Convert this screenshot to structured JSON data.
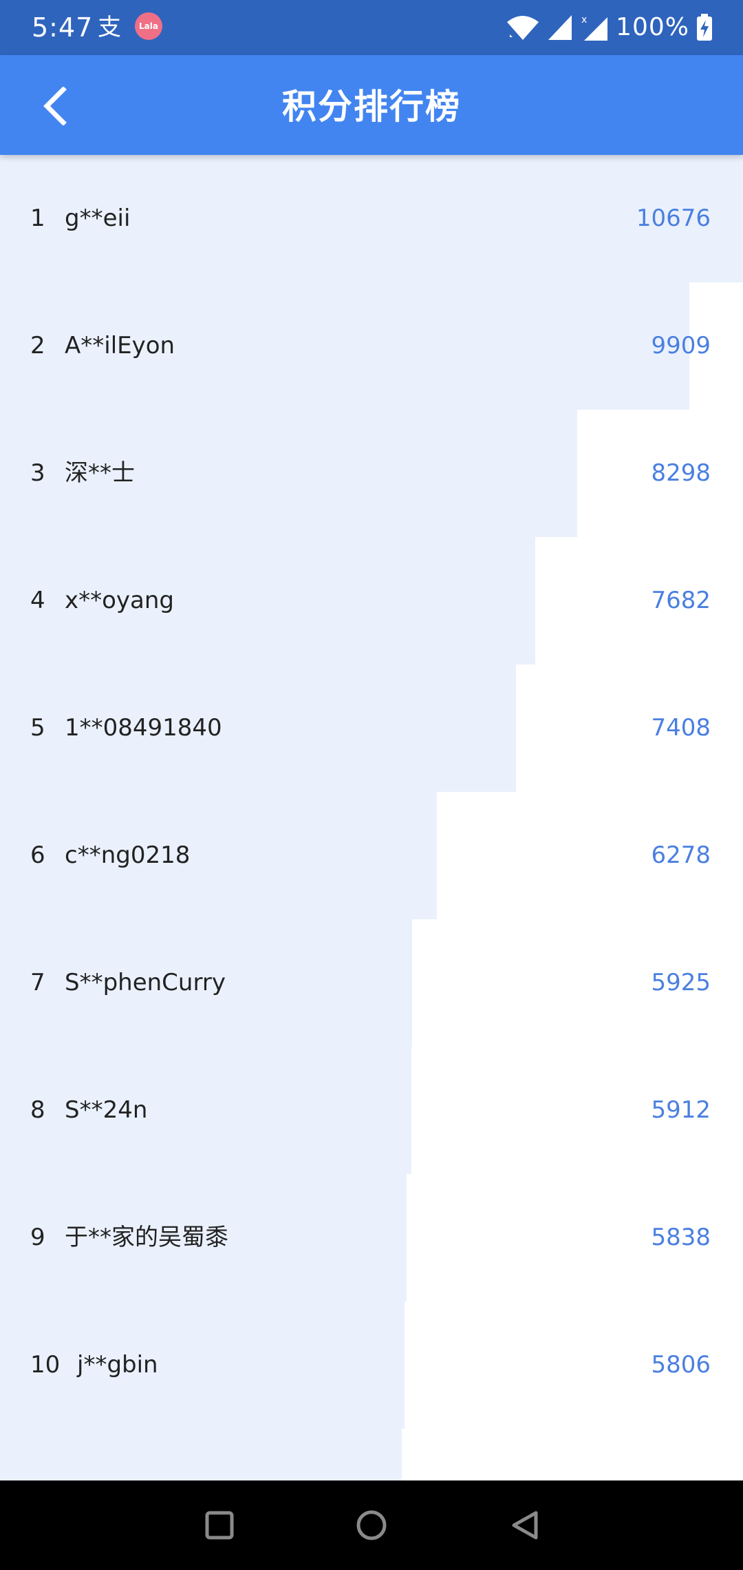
{
  "status_bar": {
    "time": "5:47",
    "notification_1": "支",
    "notification_2": "Lala",
    "battery": "100%",
    "icons": [
      "wifi-icon",
      "signal-icon",
      "signal-x-icon",
      "battery-charging-icon"
    ]
  },
  "header": {
    "title": "积分排行榜",
    "back_icon": "chevron-left-icon",
    "color": "#4285f0"
  },
  "ranking": {
    "bar_color": "#eaf1fd",
    "score_color": "#4a7fe0",
    "items": [
      {
        "rank": "1",
        "name": "g**eii",
        "score": "10676",
        "fill_ratio": 1.0
      },
      {
        "rank": "2",
        "name": "A**ilEyon",
        "score": "9909",
        "fill_ratio": 0.928
      },
      {
        "rank": "3",
        "name": "深**士",
        "score": "8298",
        "fill_ratio": 0.777
      },
      {
        "rank": "4",
        "name": "x**oyang",
        "score": "7682",
        "fill_ratio": 0.72
      },
      {
        "rank": "5",
        "name": "1**08491840",
        "score": "7408",
        "fill_ratio": 0.694
      },
      {
        "rank": "6",
        "name": "c**ng0218",
        "score": "6278",
        "fill_ratio": 0.588
      },
      {
        "rank": "7",
        "name": "S**phenCurry",
        "score": "5925",
        "fill_ratio": 0.555
      },
      {
        "rank": "8",
        "name": "S**24n",
        "score": "5912",
        "fill_ratio": 0.554
      },
      {
        "rank": "9",
        "name": "于**家的吴蜀黍",
        "score": "5838",
        "fill_ratio": 0.547
      },
      {
        "rank": "10",
        "name": "j**gbin",
        "score": "5806",
        "fill_ratio": 0.544
      }
    ],
    "partial_next_fill_ratio": 0.541
  },
  "nav_bar": {
    "buttons": [
      "recents-square-icon",
      "home-circle-icon",
      "back-triangle-icon"
    ]
  }
}
